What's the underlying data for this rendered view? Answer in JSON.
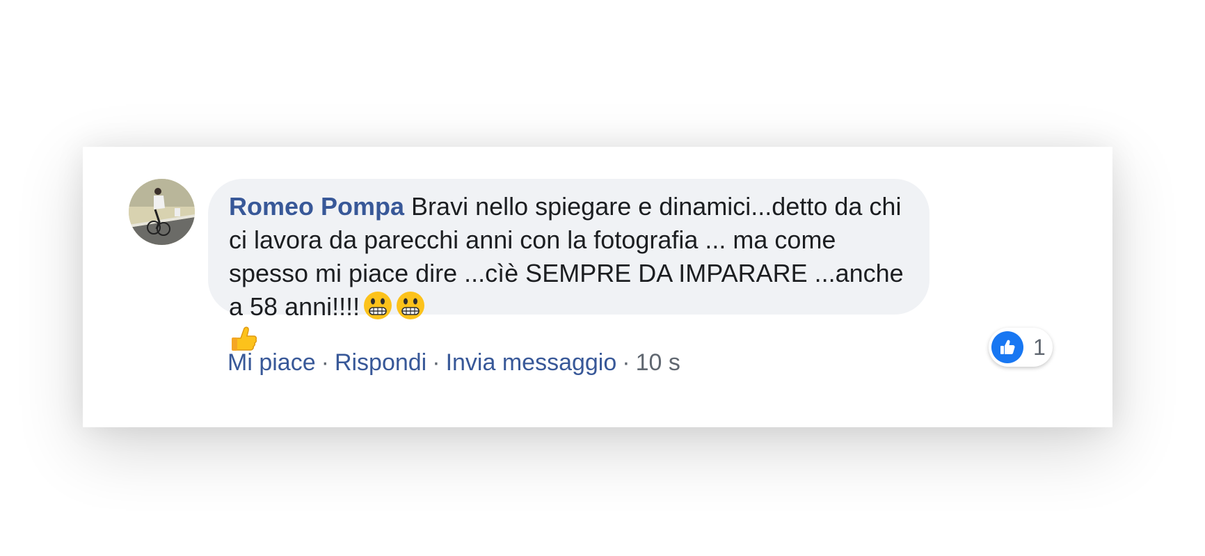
{
  "comment": {
    "author": "Romeo Pompa",
    "text": " Bravi nello spiegare e dinamici...detto da chi ci lavora da parecchi anni con la fotografia ... ma come spesso mi piace dire ...cìè SEMPRE DA IMPARARE ...anche a 58 anni!!!!",
    "emojis": [
      "grinning-face-emoji",
      "grinning-face-emoji",
      "thumbs-up-emoji"
    ]
  },
  "actions": {
    "like_label": "Mi piace",
    "reply_label": "Rispondi",
    "message_label": "Invia messaggio",
    "separator": "·",
    "timestamp": "10 s"
  },
  "reactions": {
    "icon": "like-icon",
    "count": "1"
  },
  "colors": {
    "link": "#385898",
    "bubble": "#f0f2f5",
    "like_blue": "#1877f2",
    "text": "#1c1e21",
    "meta": "#606770"
  }
}
